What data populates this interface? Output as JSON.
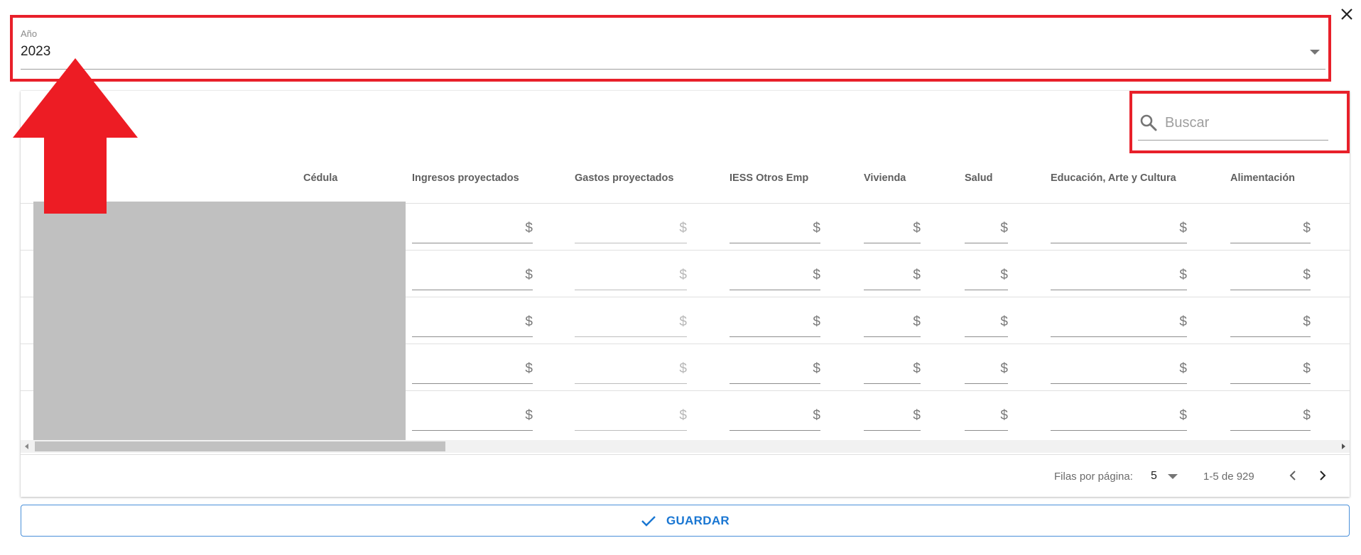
{
  "dialog": {
    "close_icon": "close-icon"
  },
  "year_select": {
    "label": "Año",
    "value": "2023"
  },
  "search": {
    "placeholder": "Buscar",
    "value": ""
  },
  "table": {
    "columns": [
      {
        "key": "cedula",
        "label": "Cédula"
      },
      {
        "key": "ingresos",
        "label": "Ingresos proyectados"
      },
      {
        "key": "gastos",
        "label": "Gastos proyectados"
      },
      {
        "key": "iess",
        "label": "IESS Otros Emp"
      },
      {
        "key": "vivienda",
        "label": "Vivienda"
      },
      {
        "key": "salud",
        "label": "Salud"
      },
      {
        "key": "educacion",
        "label": "Educación, Arte y Cultura"
      },
      {
        "key": "alimentacion",
        "label": "Alimentación"
      }
    ],
    "currency_symbol": "$",
    "row_count": 5
  },
  "pagination": {
    "rows_per_page_label": "Filas por página:",
    "rows_per_page": "5",
    "range": "1-5 de 929"
  },
  "actions": {
    "save_label": "GUARDAR"
  },
  "colors": {
    "accent": "#1976d2",
    "highlight": "#e8202a",
    "redacted": "#c0c0c0"
  }
}
